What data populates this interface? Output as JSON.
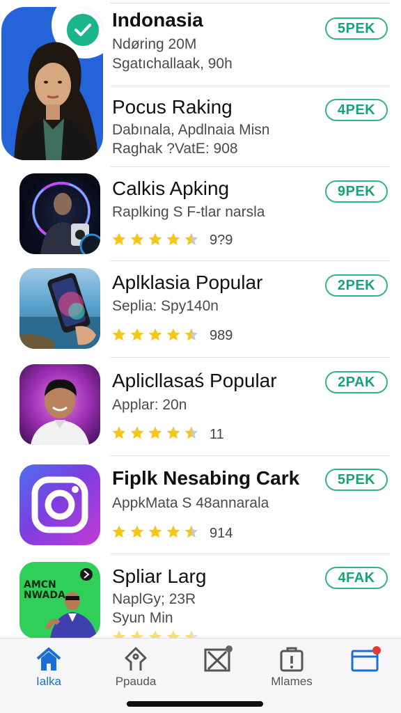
{
  "apps": [
    {
      "title": "Indonasia",
      "line1": "Ndøring 20M",
      "line2": "Sgatıchallaak, 90h",
      "badge": "5PEK"
    },
    {
      "title": "Pocus Raking",
      "line1": "Dabınala, Apdlnaia Misn",
      "line2": "Raghak ?VatE: 908",
      "badge": "4PEK"
    },
    {
      "title": "Calkis Apking",
      "line1": "Raplking S F-tlar narsla",
      "rating": "9?9",
      "stars": 4.5,
      "badge": "9PEK"
    },
    {
      "title": "Aplklasia Popular",
      "line1": "Seplia: Spy140n",
      "rating": "989",
      "stars": 4.5,
      "badge": "2PEK"
    },
    {
      "title": "Aplicllasaś Popular",
      "line1": "Applar: 20n",
      "rating": "11",
      "stars": 4.5,
      "badge": "2PAK"
    },
    {
      "title": "Fiplk Nesabing Cark",
      "line1": "AppkMata S 48annarala",
      "rating": "914",
      "stars": 4.5,
      "badge": "5PEK"
    },
    {
      "title": "Spliar Larg",
      "line1": "NaplGy; 23R",
      "line2": "Syun Min",
      "badge": "4FAK",
      "thumb_text": "AMCN NWADA"
    }
  ],
  "tabs": [
    {
      "label": "Ialka",
      "icon": "home-icon",
      "active": true
    },
    {
      "label": "Ppauda",
      "icon": "tag-icon",
      "active": false
    },
    {
      "label": "",
      "icon": "crossed-box-icon",
      "active": false
    },
    {
      "label": "Mlames",
      "icon": "alert-box-icon",
      "active": false
    },
    {
      "label": "",
      "icon": "browser-window-icon",
      "active": false
    }
  ],
  "colors": {
    "accent_green": "#2fb48a",
    "tab_active": "#1a6fd6",
    "star": "#f5c518"
  }
}
